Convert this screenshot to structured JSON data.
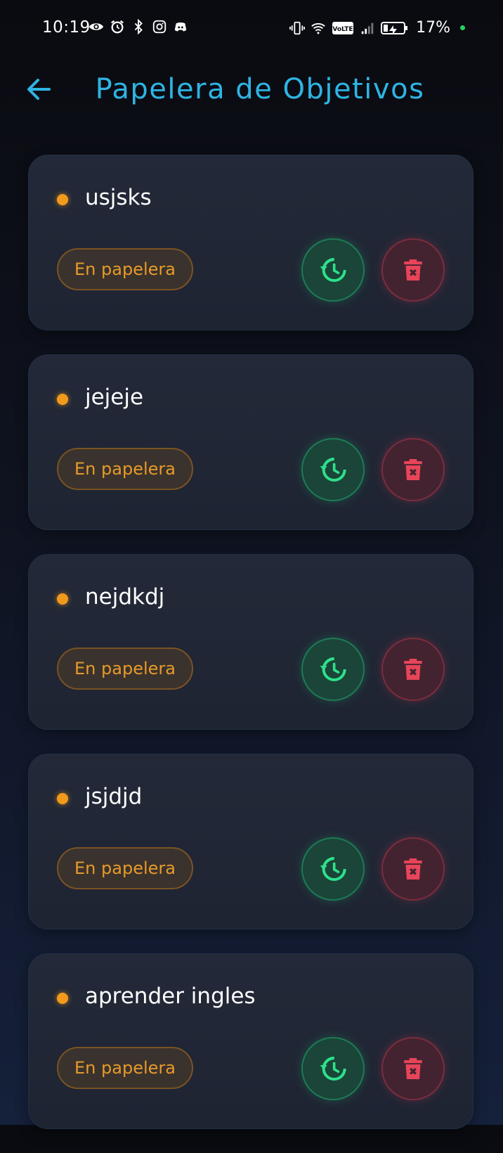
{
  "status_bar": {
    "time": "10:19",
    "battery": "17%",
    "left_icons": [
      "eye-icon",
      "alarm-icon",
      "bluetooth-icon",
      "instagram-icon",
      "discord-icon"
    ],
    "right_icons": [
      "vibrate-icon",
      "wifi-icon",
      "volte-icon",
      "signal-icon",
      "battery-icon"
    ]
  },
  "header": {
    "title": "Papelera de Objetivos",
    "back_icon": "arrow-left-icon"
  },
  "colors": {
    "accent": "#2fb4e3",
    "badge": "#e79a2a",
    "restore": "#2ee08a",
    "delete": "#e8445a"
  },
  "items": [
    {
      "title": "usjsks",
      "badge": "En papelera"
    },
    {
      "title": "jejeje",
      "badge": "En papelera"
    },
    {
      "title": "nejdkdj",
      "badge": "En papelera"
    },
    {
      "title": "jsjdjd",
      "badge": "En papelera"
    },
    {
      "title": "aprender ingles",
      "badge": "En papelera"
    }
  ]
}
